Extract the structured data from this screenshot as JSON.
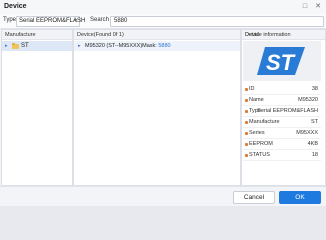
{
  "window": {
    "title": "Device"
  },
  "toolbar": {
    "type_label": "Type",
    "type_value": "Serial EEPROM&FLASH",
    "search_label": "Search",
    "search_value": "5880"
  },
  "manufacture": {
    "header": "Manufacture",
    "items": [
      {
        "label": "ST"
      }
    ]
  },
  "devices": {
    "header": "Device(Found 0f 1)",
    "items": [
      {
        "name": "M95320 (ST--M95XXX)Mask: ",
        "mask": "5880"
      }
    ]
  },
  "info": {
    "header": "Device information",
    "detail_link": "Detail",
    "logo_brand": "ST",
    "logo_color": "#2a7bd6",
    "accent_bullet_color": "#e07b2e",
    "properties": [
      {
        "label": "ID",
        "value": "38"
      },
      {
        "label": "Name",
        "value": "M95320"
      },
      {
        "label": "Type",
        "value": "Serial EEPROM&FLASH"
      },
      {
        "label": "Manufacture",
        "value": "ST"
      },
      {
        "label": "Series",
        "value": "M95XXX"
      },
      {
        "label": "EEPROM",
        "value": "4KB"
      },
      {
        "label": "STATUS",
        "value": "18"
      }
    ]
  },
  "buttons": {
    "cancel": "Cancel",
    "ok": "OK"
  },
  "icons": [
    "minimize-icon",
    "close-icon",
    "chevron-down-icon",
    "folder-icon",
    "expand-arrow-icon",
    "st-logo-icon"
  ]
}
